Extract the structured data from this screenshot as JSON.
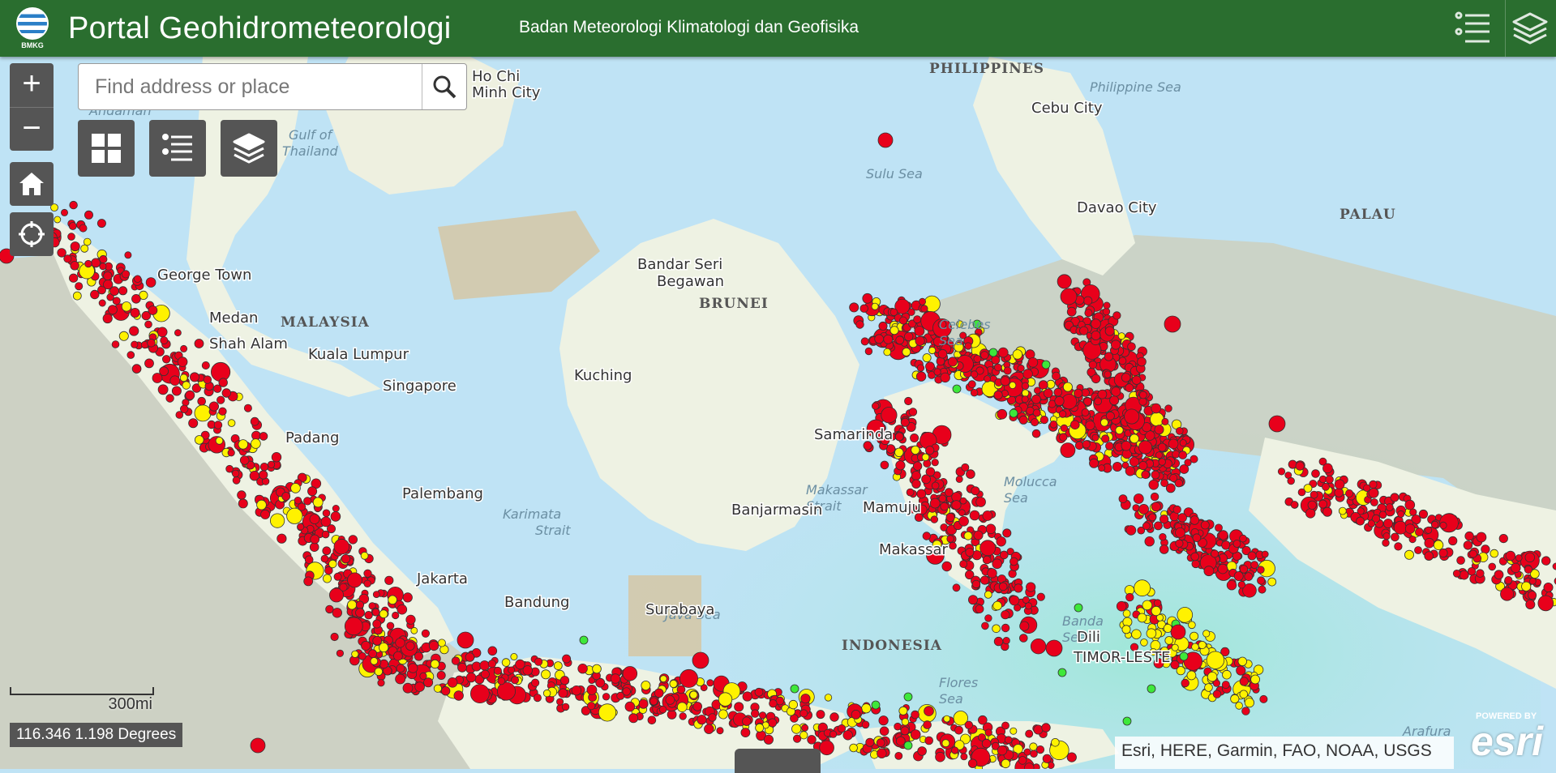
{
  "header": {
    "logo_text": "BMKG",
    "title": "Portal Geohidrometeorologi",
    "subtitle": "Badan Meteorologi Klimatologi dan Geofisika",
    "list_icon": "list-icon",
    "layers_icon": "layers-icon"
  },
  "controls": {
    "zoom_in_label": "+",
    "zoom_out_label": "−",
    "home_icon": "home-icon",
    "locate_icon": "locate-icon",
    "basemap_icon": "grid-icon",
    "legend_icon": "list-icon",
    "layers_icon": "layers-icon"
  },
  "search": {
    "placeholder": "Find address or place",
    "icon": "search-icon"
  },
  "map_labels": {
    "countries": [
      "PHILIPPINES",
      "PALAU",
      "MALAYSIA",
      "BRUNEI",
      "INDONESIA"
    ],
    "seas": [
      "Philippine Sea",
      "Sulu Sea",
      "Gulf of",
      "Thailand",
      "Celebes",
      "Sea",
      "Karimata",
      "Strait",
      "Makassar",
      "Strait",
      "Molucca",
      "Sea",
      "Java Sea",
      "Banda",
      "Sea",
      "Flores",
      "Sea",
      "Arafura",
      "Andaman"
    ],
    "cities": [
      "Ho Chi",
      "Minh City",
      "Cebu City",
      "Davao City",
      "George Town",
      "Medan",
      "Shah Alam",
      "Kuala Lumpur",
      "Singapore",
      "Bandar Seri",
      "Begawan",
      "Kuching",
      "Samarinda",
      "Padang",
      "Palembang",
      "Banjarmasin",
      "Mamuju",
      "Makassar",
      "Jakarta",
      "Bandung",
      "Surabaya",
      "Dili",
      "TIMOR-LESTE"
    ]
  },
  "scale": {
    "label": "300mi"
  },
  "coordinates": {
    "text": "116.346 1.198 Degrees"
  },
  "attribution": {
    "text": "Esri, HERE, Garmin, FAO, NOAA, USGS"
  },
  "branding": {
    "powered_by": "POWERED BY",
    "name": "esri"
  },
  "colors": {
    "header": "#2a6e2f",
    "sea": "#bfe3f5",
    "land": "#f2efe6",
    "marker_shallow": "#e8001b",
    "marker_intermediate": "#fff200",
    "marker_deep": "#3ee83a"
  }
}
